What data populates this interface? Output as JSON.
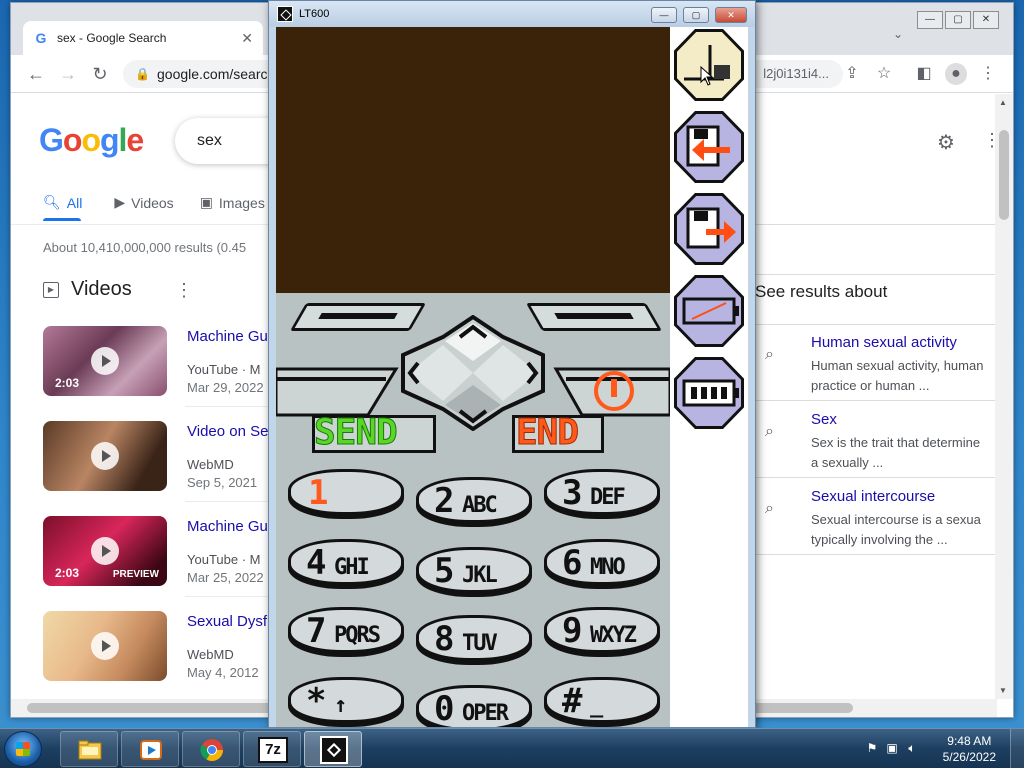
{
  "browser": {
    "tab_title": "sex - Google Search",
    "url": "google.com/search",
    "url_right": "l2j0i131i4...",
    "search_query": "sex"
  },
  "google": {
    "logo": "Google",
    "tabs": [
      {
        "label": "All"
      },
      {
        "label": "Videos"
      },
      {
        "label": "Images"
      }
    ],
    "stats": "About 10,410,000,000 results (0.45",
    "videos_heading": "Videos",
    "videos": [
      {
        "title": "Machine Gu",
        "source": "YouTube · M",
        "date": "Mar 29, 2022",
        "duration": "2:03",
        "badge": ""
      },
      {
        "title": "Video on Se",
        "source": "WebMD",
        "date": "Sep 5, 2021",
        "duration": "",
        "badge": ""
      },
      {
        "title": "Machine Gu",
        "source": "YouTube · M",
        "date": "Mar 25, 2022",
        "duration": "2:03",
        "badge": "PREVIEW"
      },
      {
        "title": "Sexual Dysf",
        "source": "WebMD",
        "date": "May 4, 2012",
        "duration": "",
        "badge": ""
      }
    ],
    "see_results_about": "See results about",
    "related": [
      {
        "title": "Human sexual activity",
        "desc1": "Human sexual activity, human",
        "desc2": "practice or human ..."
      },
      {
        "title": "Sex",
        "desc1": "Sex is the trait that determine",
        "desc2": "a sexually ..."
      },
      {
        "title": "Sexual intercourse",
        "desc1": "Sexual intercourse is a sexua",
        "desc2": "typically involving the ..."
      }
    ]
  },
  "emulator": {
    "title": "LT600",
    "send_label": "SEND",
    "end_label": "END",
    "keys": [
      {
        "num": "1",
        "letters": ""
      },
      {
        "num": "2",
        "letters": "ABC"
      },
      {
        "num": "3",
        "letters": "DEF"
      },
      {
        "num": "4",
        "letters": "GHI"
      },
      {
        "num": "5",
        "letters": "JKL"
      },
      {
        "num": "6",
        "letters": "MNO"
      },
      {
        "num": "7",
        "letters": "PQRS"
      },
      {
        "num": "8",
        "letters": "TUV"
      },
      {
        "num": "9",
        "letters": "WXYZ"
      },
      {
        "num": "*",
        "letters": "↑"
      },
      {
        "num": "0",
        "letters": "OPER"
      },
      {
        "num": "#",
        "letters": "_"
      }
    ],
    "side_buttons": [
      "hand-pointer-icon",
      "floppy-load-icon",
      "floppy-save-icon",
      "battery-empty-icon",
      "battery-full-icon"
    ]
  },
  "taskbar": {
    "time": "9:48 AM",
    "date": "5/26/2022",
    "sevenzip_label": "7z"
  },
  "colors": {
    "screen": "#3b2309",
    "send": "#5ad627",
    "end": "#ff5a1c",
    "link": "#1a0dab",
    "accent": "#1a73e8"
  }
}
